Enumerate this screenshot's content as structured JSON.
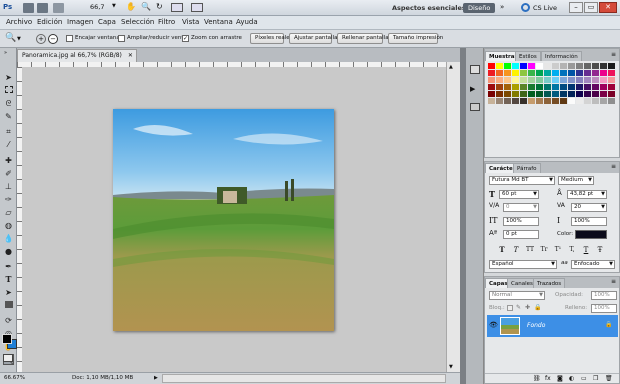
{
  "app": {
    "logo": "Ps",
    "zoom": "66,7",
    "workspace_label": "Aspectos esenciales",
    "workspace_button": "Diseño",
    "cslive": "CS Live"
  },
  "menu": [
    "Archivo",
    "Edición",
    "Imagen",
    "Capa",
    "Selección",
    "Filtro",
    "Vista",
    "Ventana",
    "Ayuda"
  ],
  "options": {
    "resize_windows": "Encajar ventana",
    "zoom_all": "Ampliar/reducir vent.",
    "scrubby_zoom": "Zoom con arrastre",
    "actual_pixels": "Píxeles reales",
    "fit_screen": "Ajustar pantalla",
    "fill_screen": "Rellenar pantalla",
    "print_size": "Tamaño impresión"
  },
  "document": {
    "tab_title": "Panoramica.jpg al 66,7% (RGB/8)",
    "zoom_status": "66.67%",
    "doc_size": "Doc: 1,10 MB/1,10 MB"
  },
  "swatches_panel": {
    "tabs": [
      "Muestras",
      "Estilos",
      "Información"
    ],
    "colors": [
      "#ff0000",
      "#ffff00",
      "#00ff00",
      "#00ffff",
      "#0000ff",
      "#ff00ff",
      "#ffffff",
      "#e6e6e6",
      "#cccccc",
      "#b3b3b3",
      "#999999",
      "#808080",
      "#666666",
      "#4d4d4d",
      "#333333",
      "#1a1a1a",
      "#ed1c24",
      "#f26522",
      "#f7941d",
      "#fff200",
      "#8dc63f",
      "#39b54a",
      "#00a651",
      "#00a99d",
      "#00aeef",
      "#0072bc",
      "#0054a6",
      "#2e3192",
      "#662d91",
      "#92278f",
      "#ec008c",
      "#ed145b",
      "#f69679",
      "#f9ad81",
      "#fdc689",
      "#fff799",
      "#c4df9b",
      "#a3d39c",
      "#82ca9c",
      "#7accc8",
      "#6dcff6",
      "#7da7d9",
      "#8393ca",
      "#8781bd",
      "#a186be",
      "#bd8cbf",
      "#f49ac2",
      "#f6989d",
      "#9e0b0f",
      "#a0410d",
      "#a36209",
      "#aba000",
      "#598527",
      "#1a7b30",
      "#007236",
      "#00746b",
      "#0076a3",
      "#004b80",
      "#003471",
      "#1b1464",
      "#440e62",
      "#630460",
      "#9e005d",
      "#9e0039",
      "#790000",
      "#7b2e00",
      "#7d4900",
      "#827b00",
      "#406618",
      "#005e20",
      "#005826",
      "#005952",
      "#005b7f",
      "#003663",
      "#002157",
      "#0d004c",
      "#32004b",
      "#4b0049",
      "#7b0046",
      "#7a0026",
      "#c7b299",
      "#998675",
      "#736357",
      "#534741",
      "#37302a",
      "#c69c6d",
      "#a67c52",
      "#8c6239",
      "#754c24",
      "#603913",
      "#fbfbfb",
      "#ebebeb",
      "#d4d4d4",
      "#bdbdbd",
      "#a6a6a6",
      "#8f8f8f"
    ]
  },
  "character_panel": {
    "tabs": [
      "Carácter",
      "Párrafo"
    ],
    "font_family": "Futura Md BT",
    "font_style": "Medium",
    "font_size": "60 pt",
    "leading": "43,82 pt",
    "kerning": "0",
    "tracking": "20",
    "vscale": "100%",
    "hscale": "100%",
    "baseline": "0 pt",
    "color_label": "Color:",
    "color_value": "#0b0b1a",
    "type_buttons": [
      "T",
      "T",
      "TT",
      "Tr",
      "T¹",
      "T,",
      "T",
      "Ŧ"
    ],
    "language": "Español",
    "antialias": "Enfocado",
    "antialias_prefix": "aa"
  },
  "layers_panel": {
    "tabs": [
      "Capas",
      "Canales",
      "Trazados"
    ],
    "blend_mode": "Normal",
    "opacity_label": "Opacidad:",
    "opacity_value": "100%",
    "lock_label": "Bloq.:",
    "fill_label": "Relleno:",
    "fill_value": "100%",
    "layers": [
      {
        "name": "Fondo",
        "selected": true
      }
    ]
  },
  "colors": {
    "accent": "#3d8fe6",
    "foreground": "#000000",
    "background": "#1f7fd6"
  }
}
